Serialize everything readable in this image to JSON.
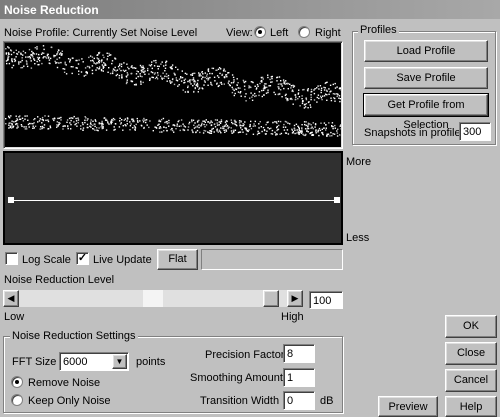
{
  "window": {
    "title": "Noise Reduction"
  },
  "profile": {
    "label": "Noise Profile: Currently Set Noise Level",
    "view_label": "View:",
    "view_left": "Left",
    "view_right": "Right",
    "selected_view": "Left"
  },
  "profiles_group": {
    "title": "Profiles",
    "load_button": "Load Profile",
    "save_button": "Save Profile",
    "get_button": "Get Profile from Selection",
    "snapshots_label": "Snapshots in profile",
    "snapshots_value": "300"
  },
  "curve": {
    "more_label": "More",
    "less_label": "Less"
  },
  "options": {
    "log_scale": "Log Scale",
    "log_scale_checked": false,
    "live_update": "Live Update",
    "live_update_checked": true,
    "flat_button": "Flat"
  },
  "level": {
    "label": "Noise Reduction Level",
    "low": "Low",
    "high": "High",
    "value": "100",
    "fraction": 0.97
  },
  "settings": {
    "title": "Noise Reduction Settings",
    "fft_label": "FFT Size",
    "fft_value": "6000",
    "fft_unit": "points",
    "remove_noise": "Remove Noise",
    "keep_only_noise": "Keep Only Noise",
    "selected_mode": "Remove Noise",
    "precision_label": "Precision Factor",
    "precision_value": "8",
    "smoothing_label": "Smoothing Amount",
    "smoothing_value": "1",
    "transition_label": "Transition Width",
    "transition_value": "0",
    "transition_unit": "dB"
  },
  "buttons": {
    "ok": "OK",
    "close": "Close",
    "cancel": "Cancel",
    "preview": "Preview",
    "help": "Help"
  }
}
